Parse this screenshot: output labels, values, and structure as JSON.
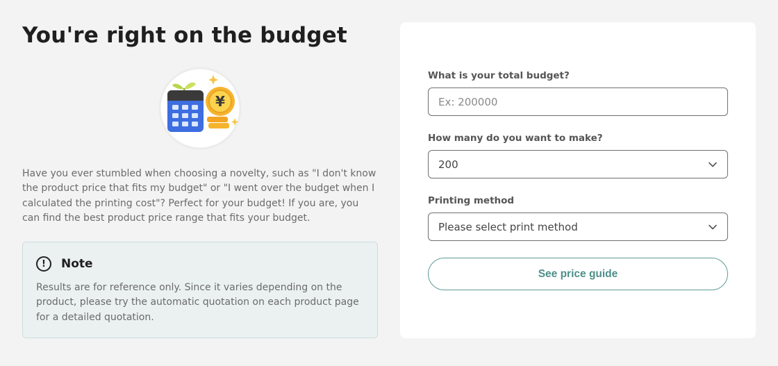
{
  "hero": {
    "title": "You're right on the budget",
    "illustration_icon": "calculator-yen-coin-icon",
    "description": "Have you ever stumbled when choosing a novelty, such as \"I don't know the product price that fits my budget\" or \"I went over the budget when I calculated the printing cost\"? Perfect for your budget! If you are, you can find the best product price range that fits your budget."
  },
  "note": {
    "icon": "exclamation-circle-icon",
    "icon_glyph": "!",
    "title": "Note",
    "text": "Results are for reference only. Since it varies depending on the product, please try the automatic quotation on each product page for a detailed quotation."
  },
  "form": {
    "budget": {
      "label": "What is your total budget?",
      "placeholder": "Ex: 200000"
    },
    "quantity": {
      "label": "How many do you want to make?",
      "value": "200"
    },
    "print_method": {
      "label": "Printing method",
      "placeholder": "Please select print method"
    },
    "submit_label": "See price guide"
  },
  "colors": {
    "page_bg": "#f3f3f3",
    "accent": "#4e8f89",
    "note_bg": "#ebf1f1"
  }
}
